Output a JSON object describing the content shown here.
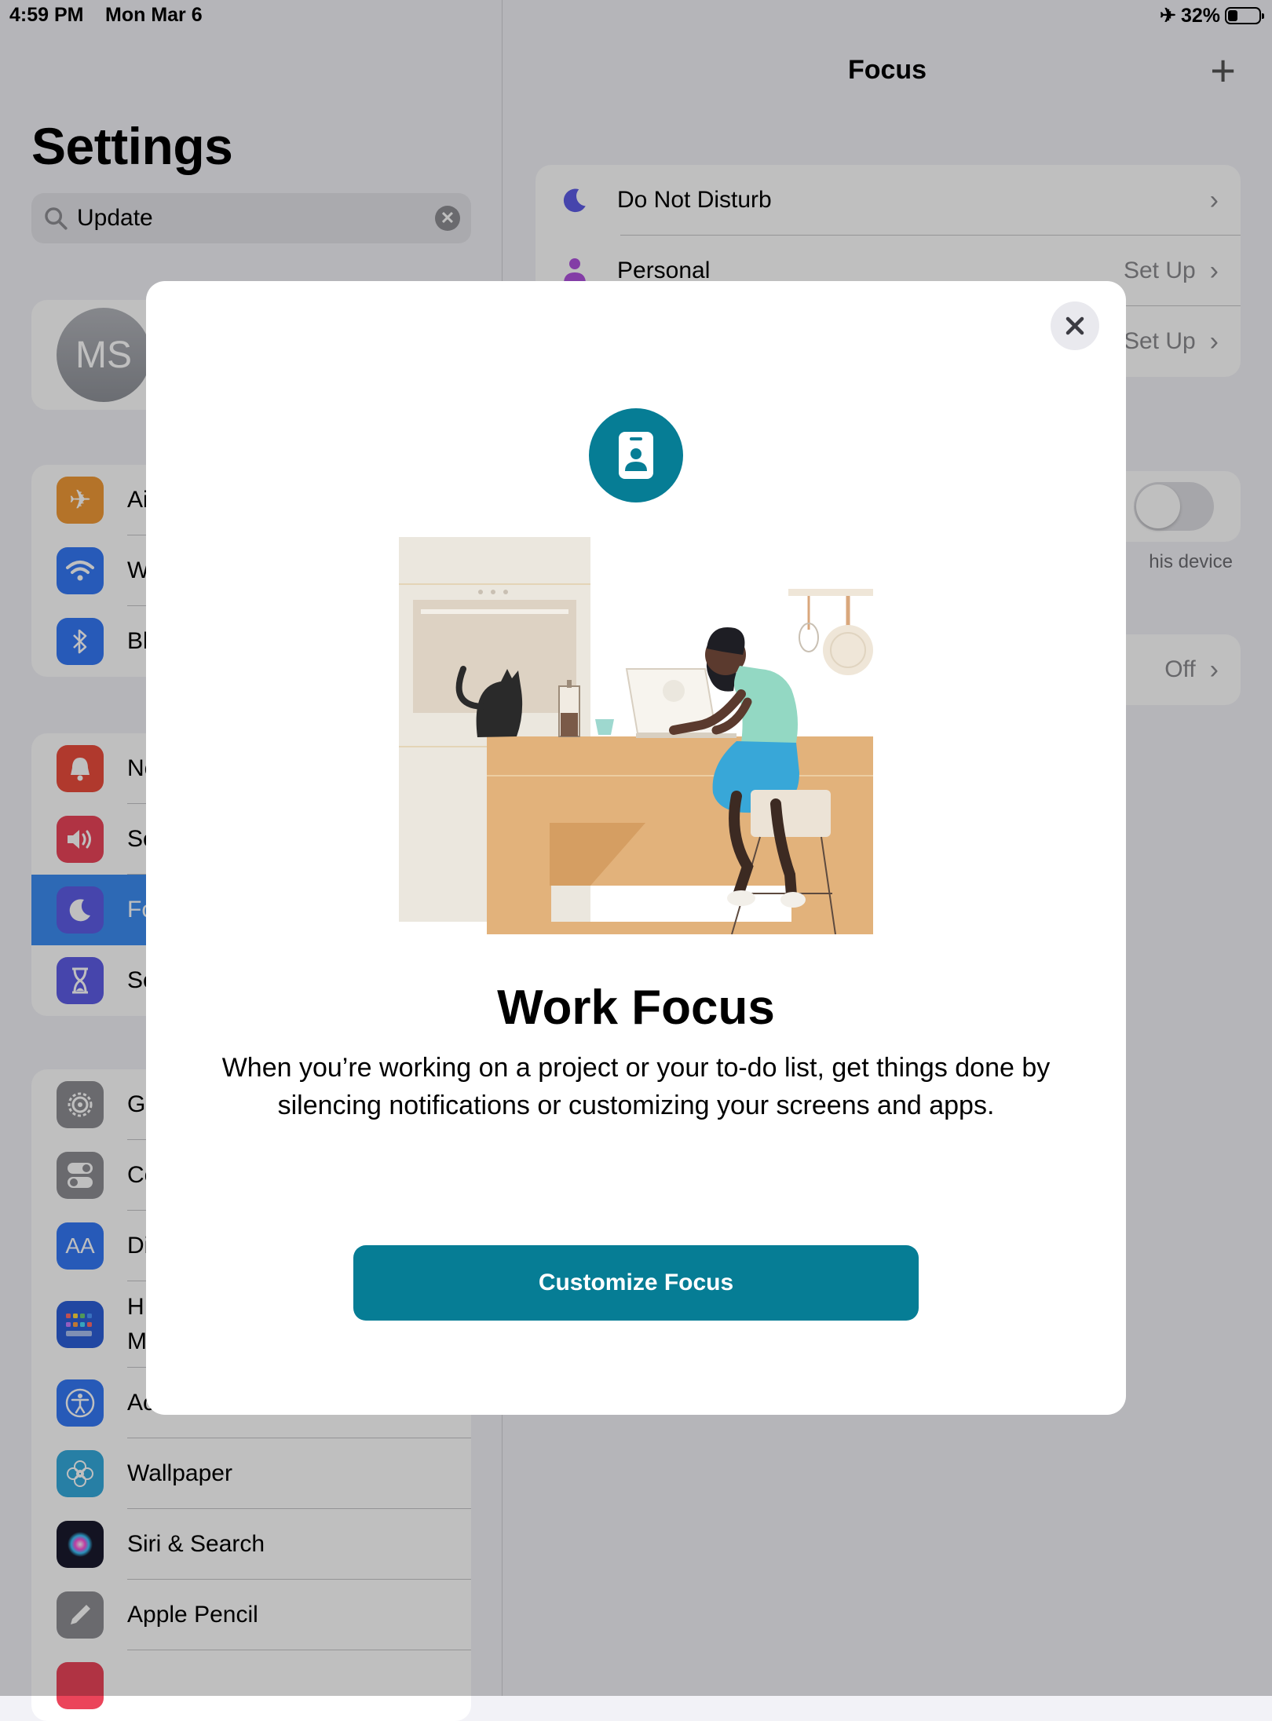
{
  "status_bar": {
    "time": "4:59 PM",
    "date": "Mon Mar 6",
    "battery": "32%",
    "battery_level": 0.32
  },
  "sidebar": {
    "title": "Settings",
    "search": {
      "value": "Update"
    },
    "profile": {
      "initials": "MS"
    },
    "groups": [
      [
        {
          "label": "Ai",
          "icon": "airplane-icon",
          "color": "#f09a37"
        },
        {
          "label": "W",
          "icon": "wifi-icon",
          "color": "#3478f6"
        },
        {
          "label": "Bl",
          "icon": "bluetooth-icon",
          "color": "#3478f6"
        }
      ],
      [
        {
          "label": "No",
          "icon": "bell-icon",
          "color": "#eb4d3d"
        },
        {
          "label": "Sc",
          "icon": "speaker-icon",
          "color": "#eb445a"
        },
        {
          "label": "Fo",
          "icon": "moon-icon",
          "color": "#5e5ce6",
          "selected": true
        },
        {
          "label": "Sc",
          "icon": "hourglass-icon",
          "color": "#5e5ce6"
        }
      ],
      [
        {
          "label": "Ge",
          "icon": "gear-icon",
          "color": "#8e8e93"
        },
        {
          "label": "Co",
          "icon": "switches-icon",
          "color": "#8e8e93"
        },
        {
          "label": "Di",
          "icon": "text-size-icon",
          "color": "#3478f6"
        },
        {
          "label": "H",
          "label2": "M",
          "icon": "home-screen-icon",
          "color": "#2c5fd9"
        },
        {
          "label": "Accessibility",
          "icon": "accessibility-icon",
          "color": "#3478f6"
        },
        {
          "label": "Wallpaper",
          "icon": "flower-icon",
          "color": "#35aadc"
        },
        {
          "label": "Siri & Search",
          "icon": "siri-icon",
          "color": "#222"
        },
        {
          "label": "Apple Pencil",
          "icon": "pencil-icon",
          "color": "#8e8e93"
        }
      ]
    ]
  },
  "detail": {
    "title": "Focus",
    "focus_list": [
      {
        "label": "Do Not Disturb",
        "value": "",
        "icon": "moon-icon",
        "color": "#5e5ce6"
      },
      {
        "label": "Personal",
        "value": "Set Up",
        "icon": "person-icon",
        "color": "#af52de"
      },
      {
        "label": "",
        "value": "Set Up",
        "icon": "",
        "color": ""
      }
    ],
    "share_toggle": {
      "on": false
    },
    "footnote": "his device",
    "status_row": {
      "value": "Off"
    }
  },
  "modal": {
    "title": "Work Focus",
    "description": "When you’re working on a project or your to-do list, get things done by silencing notifications or customizing your screens and apps.",
    "button": "Customize Focus",
    "badge_icon": "id-badge-icon",
    "accent": "#067d95"
  }
}
